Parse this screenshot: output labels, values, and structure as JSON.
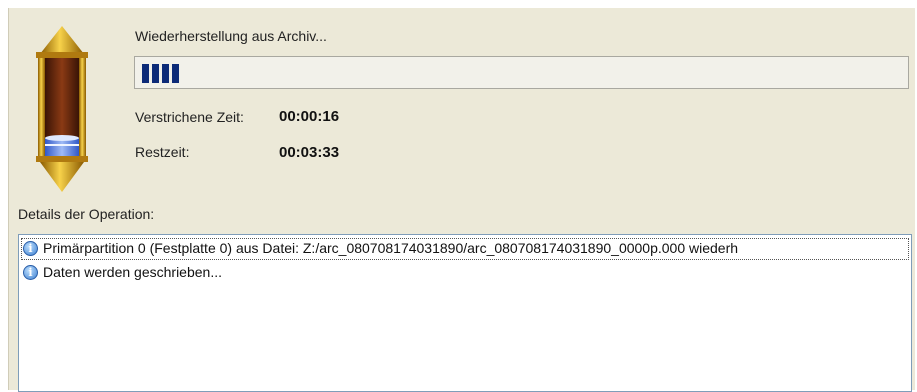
{
  "operation": {
    "title": "Wiederherstellung aus Archiv...",
    "progress_fraction": 0.05,
    "icon": "hourglass-icon"
  },
  "stats": {
    "elapsed_label": "Verstrichene Zeit:",
    "elapsed_value": "00:00:16",
    "remaining_label": "Restzeit:",
    "remaining_value": "00:03:33"
  },
  "details": {
    "label": "Details der Operation:",
    "items": [
      {
        "icon": "info-icon",
        "text": "Primärpartition 0 (Festplatte 0) aus Datei: Z:/arc_080708174031890/arc_080708174031890_0000p.000 wiederh"
      },
      {
        "icon": "info-icon",
        "text": "Daten werden geschrieben..."
      }
    ]
  },
  "colors": {
    "panel": "#ece9d8",
    "progress_segment": "#0c2a78",
    "hourglass_gold": "#d9a620",
    "hourglass_glass": "#6b2a10"
  }
}
